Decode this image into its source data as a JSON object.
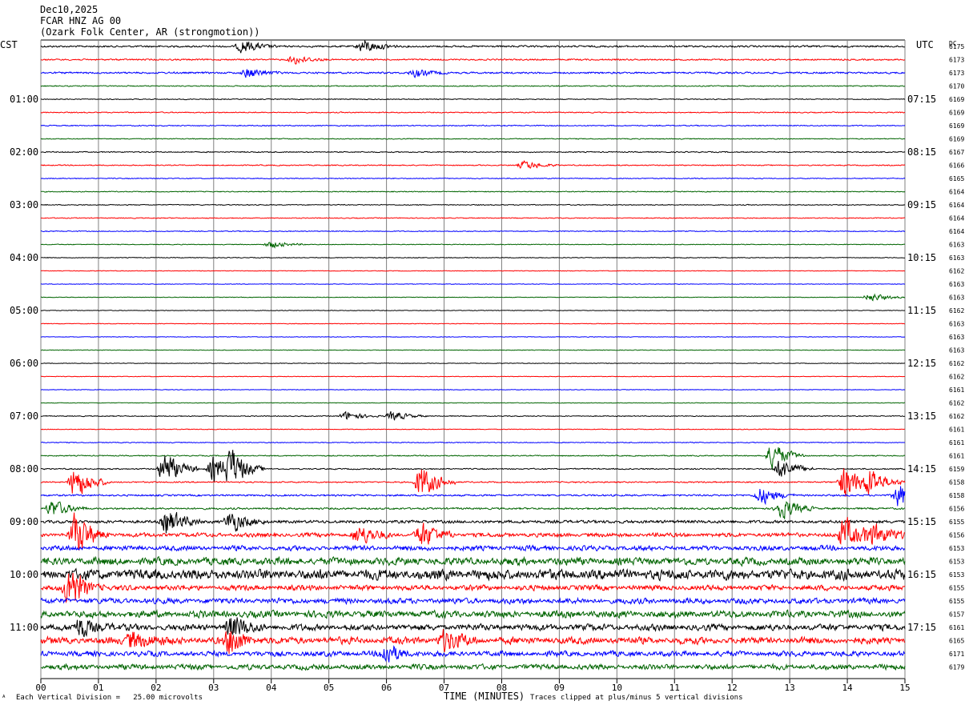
{
  "header": {
    "date": "Dec10,2025",
    "station": "FCAR HNZ AG 00",
    "location": "(Ozark Folk Center, AR (strongmotion))"
  },
  "left_axis": {
    "label": "CST"
  },
  "right_axis": {
    "label": "UTC",
    "dc_label": "DC"
  },
  "footer": {
    "corner_mark": "ᴬ",
    "scale_note": "Each Vertical Division =   25.00 microvolts",
    "clip_note": "Traces clipped at plus/minus 5 vertical divisions"
  },
  "colors": {
    "cycle": [
      "#000000",
      "#ff0000",
      "#0000ff",
      "#006400"
    ],
    "grid": "#808080"
  },
  "chart_data": {
    "type": "line",
    "title": "FCAR HNZ AG 00",
    "xlabel": "TIME (MINUTES)",
    "xlim": [
      0,
      15
    ],
    "x_ticks": [
      "00",
      "01",
      "02",
      "03",
      "04",
      "05",
      "06",
      "07",
      "08",
      "09",
      "10",
      "11",
      "12",
      "13",
      "14",
      "15"
    ],
    "grid": true,
    "rows_per_hour": 4,
    "left_hour_labels": [
      "01:00",
      "02:00",
      "03:00",
      "04:00",
      "05:00",
      "06:00",
      "07:00",
      "08:00",
      "09:00",
      "10:00",
      "11:00"
    ],
    "right_hour_labels": [
      "07:15",
      "08:15",
      "09:15",
      "10:15",
      "11:15",
      "12:15",
      "13:15",
      "14:15",
      "15:15",
      "16:15",
      "17:15"
    ],
    "dc_offsets": [
      "6175",
      "6173",
      "6173",
      "6170",
      "6169",
      "6169",
      "6169",
      "6169",
      "6167",
      "6166",
      "6165",
      "6164",
      "6164",
      "6164",
      "6164",
      "6163",
      "6163",
      "6162",
      "6163",
      "6163",
      "6162",
      "6163",
      "6163",
      "6163",
      "6162",
      "6162",
      "6161",
      "6162",
      "6162",
      "6161",
      "6161",
      "6161",
      "6159",
      "6158",
      "6158",
      "6156",
      "6155",
      "6156",
      "6153",
      "6153",
      "6153",
      "6155",
      "6155",
      "6157",
      "6161",
      "6165",
      "6171",
      "6179"
    ],
    "row_activity": [
      0.6,
      0.5,
      0.6,
      0.35,
      0.3,
      0.35,
      0.35,
      0.3,
      0.35,
      0.35,
      0.3,
      0.3,
      0.3,
      0.3,
      0.3,
      0.25,
      0.25,
      0.2,
      0.2,
      0.2,
      0.2,
      0.2,
      0.2,
      0.2,
      0.2,
      0.2,
      0.2,
      0.2,
      0.3,
      0.25,
      0.3,
      0.35,
      0.4,
      0.45,
      0.6,
      0.6,
      1.0,
      1.2,
      1.4,
      2.2,
      3.0,
      1.5,
      1.6,
      2.0,
      1.8,
      2.0,
      1.5,
      1.5
    ],
    "events": [
      {
        "row": 0,
        "t": 3.5,
        "amp": 1.5
      },
      {
        "row": 0,
        "t": 5.6,
        "amp": 1.6
      },
      {
        "row": 1,
        "t": 4.4,
        "amp": 1.0
      },
      {
        "row": 2,
        "t": 3.6,
        "amp": 1.2
      },
      {
        "row": 2,
        "t": 6.5,
        "amp": 0.9
      },
      {
        "row": 9,
        "t": 8.4,
        "amp": 1.0
      },
      {
        "row": 15,
        "t": 4.0,
        "amp": 0.8
      },
      {
        "row": 19,
        "t": 14.4,
        "amp": 1.0
      },
      {
        "row": 28,
        "t": 5.3,
        "amp": 1.0
      },
      {
        "row": 28,
        "t": 6.1,
        "amp": 1.1
      },
      {
        "row": 31,
        "t": 12.7,
        "amp": 3.0
      },
      {
        "row": 32,
        "t": 2.15,
        "amp": 4.0
      },
      {
        "row": 32,
        "t": 3.0,
        "amp": 3.0
      },
      {
        "row": 32,
        "t": 3.3,
        "amp": 4.0
      },
      {
        "row": 32,
        "t": 12.85,
        "amp": 2.5
      },
      {
        "row": 33,
        "t": 0.6,
        "amp": 4.0
      },
      {
        "row": 33,
        "t": 6.6,
        "amp": 4.0
      },
      {
        "row": 33,
        "t": 13.95,
        "amp": 4.0
      },
      {
        "row": 33,
        "t": 14.4,
        "amp": 3.0
      },
      {
        "row": 34,
        "t": 12.5,
        "amp": 2.0
      },
      {
        "row": 34,
        "t": 14.9,
        "amp": 3.0
      },
      {
        "row": 35,
        "t": 0.2,
        "amp": 2.0
      },
      {
        "row": 35,
        "t": 12.85,
        "amp": 2.5
      },
      {
        "row": 36,
        "t": 2.2,
        "amp": 3.0
      },
      {
        "row": 36,
        "t": 3.3,
        "amp": 2.5
      },
      {
        "row": 37,
        "t": 0.6,
        "amp": 4.0
      },
      {
        "row": 37,
        "t": 5.5,
        "amp": 2.0
      },
      {
        "row": 37,
        "t": 6.6,
        "amp": 2.5
      },
      {
        "row": 37,
        "t": 13.95,
        "amp": 3.0
      },
      {
        "row": 37,
        "t": 14.4,
        "amp": 3.0
      },
      {
        "row": 41,
        "t": 0.5,
        "amp": 4.0
      },
      {
        "row": 44,
        "t": 0.7,
        "amp": 2.0
      },
      {
        "row": 44,
        "t": 3.3,
        "amp": 2.0
      },
      {
        "row": 45,
        "t": 1.6,
        "amp": 2.5
      },
      {
        "row": 45,
        "t": 3.3,
        "amp": 2.5
      },
      {
        "row": 45,
        "t": 7.0,
        "amp": 2.0
      },
      {
        "row": 46,
        "t": 6.0,
        "amp": 1.8
      }
    ],
    "clip_divisions": 5
  }
}
